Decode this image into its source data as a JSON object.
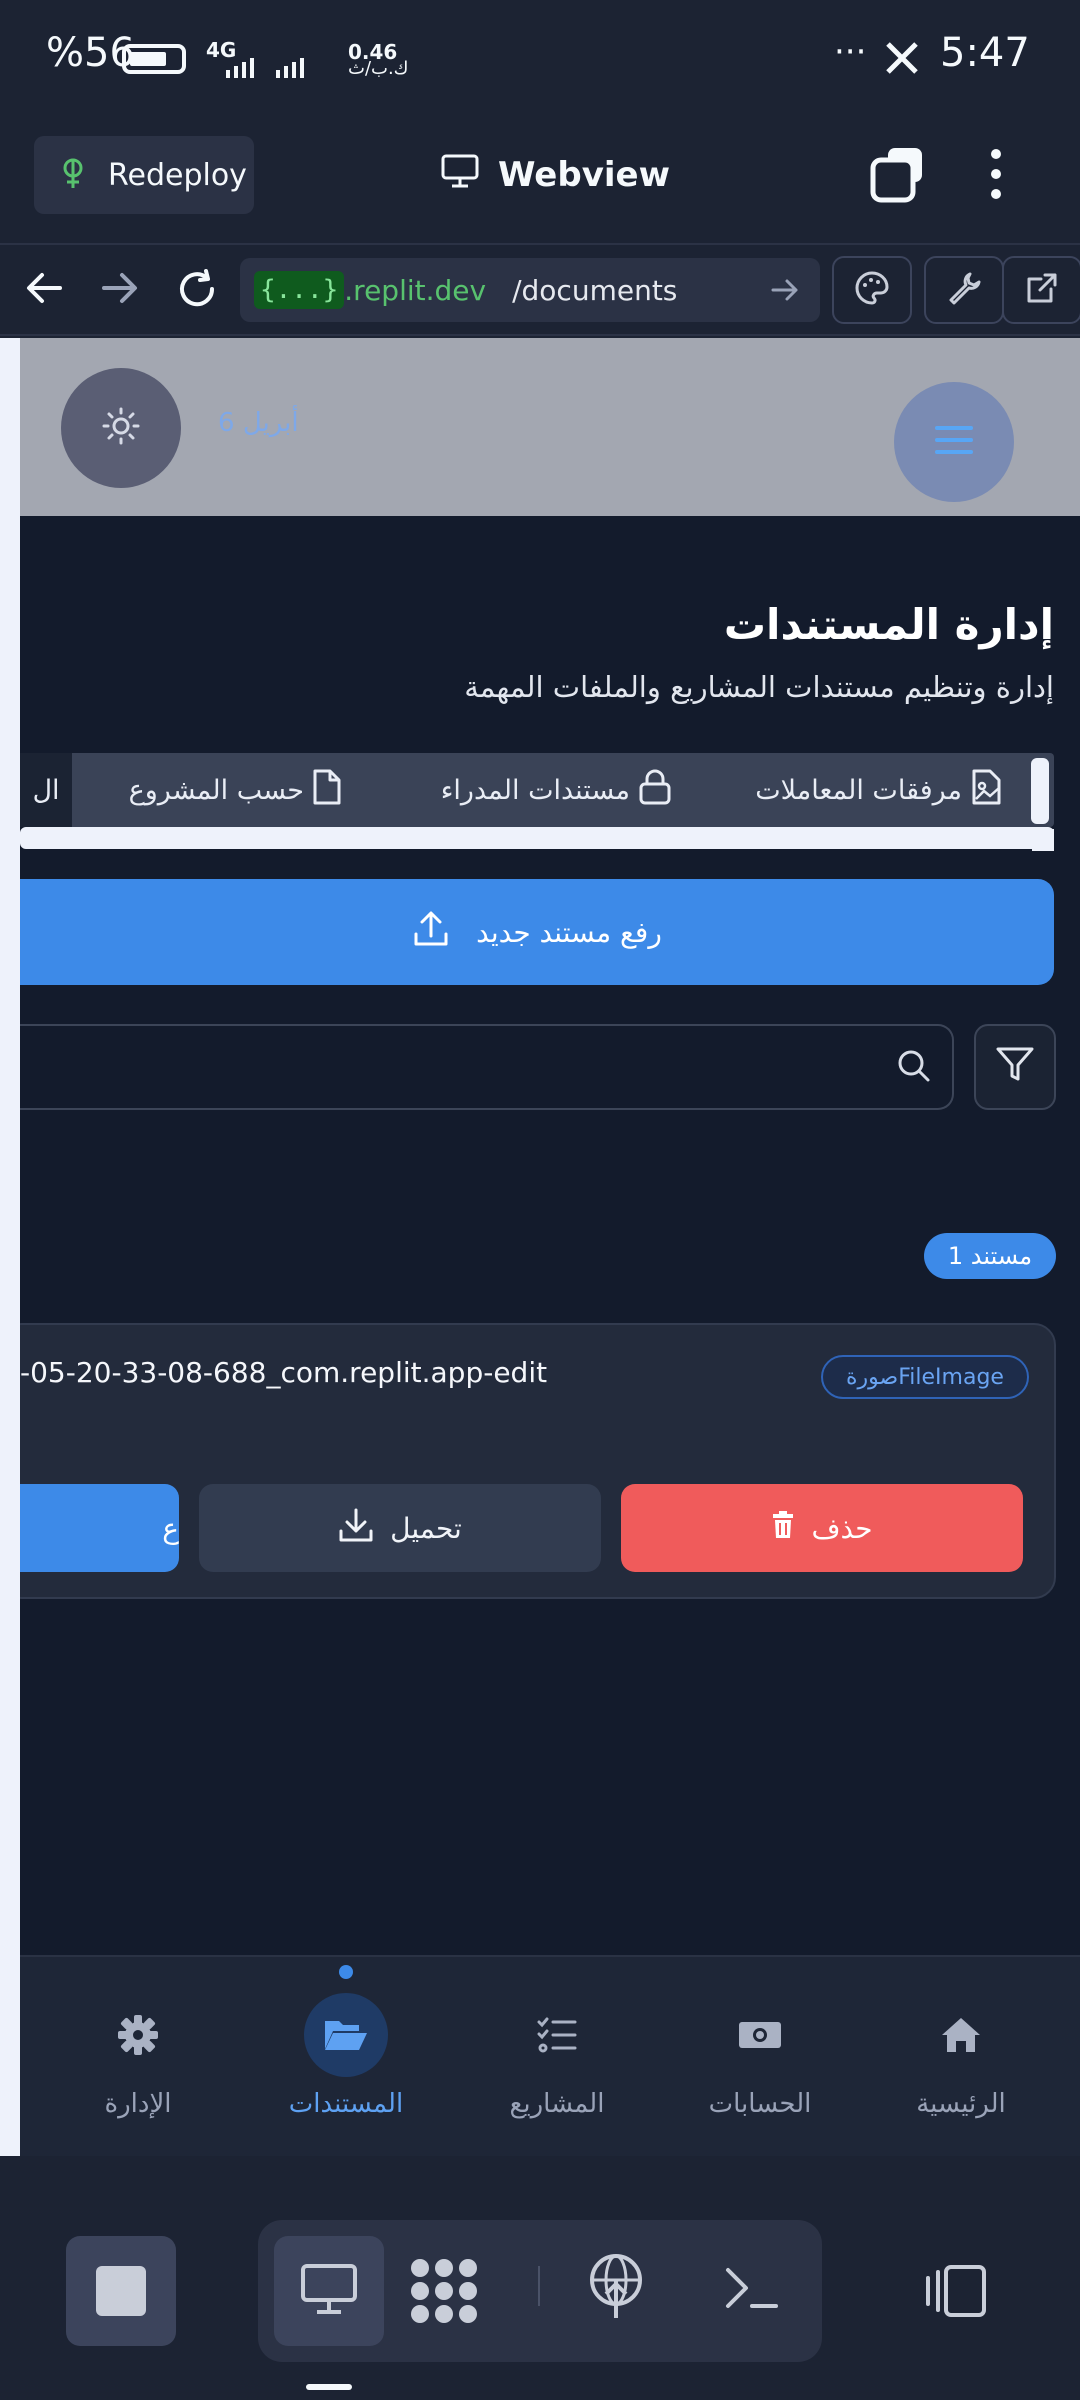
{
  "status_bar": {
    "battery_percent": "%56",
    "network": "4G",
    "speed_value": "0.46",
    "speed_unit": "ك.ب/ث",
    "more": "···",
    "time": "5:47"
  },
  "replit": {
    "redeploy_label": "Redeploy",
    "webview_title": "Webview",
    "url_badge": "{...}",
    "url_host": ".replit.dev",
    "url_path": "/documents"
  },
  "app": {
    "date": "6 أبريل",
    "page_title": "إدارة المستندات",
    "page_subtitle": "إدارة وتنظيم مستندات المشاريع والملفات المهمة",
    "tabs": [
      {
        "label": "مرفقات المعاملات",
        "icon": "file-image-icon"
      },
      {
        "label": "مستندات المدراء",
        "icon": "lock-icon"
      },
      {
        "label": "حسب المشروع",
        "icon": "file-icon"
      },
      {
        "label": "ال"
      }
    ],
    "upload_label": "رفع مستند جديد",
    "count_badge": "مستند 1",
    "document": {
      "name": "-05-20-33-08-688_com.replit.app-edit",
      "type_badge": "صورةFileImage",
      "delete_label": "حذف",
      "download_label": "تحميل",
      "third_label": "ع"
    },
    "nav": [
      {
        "label": "الرئيسية",
        "icon": "home-icon"
      },
      {
        "label": "الحسابات",
        "icon": "money-icon"
      },
      {
        "label": "المشاريع",
        "icon": "tasks-icon"
      },
      {
        "label": "المستندات",
        "icon": "folder-open-icon",
        "active": true
      },
      {
        "label": "الإدارة",
        "icon": "gear-icon"
      }
    ]
  },
  "colors": {
    "accent": "#3d8ae8",
    "danger": "#f05b5b",
    "background": "#131b2c",
    "replit_bg": "#1c2333"
  }
}
